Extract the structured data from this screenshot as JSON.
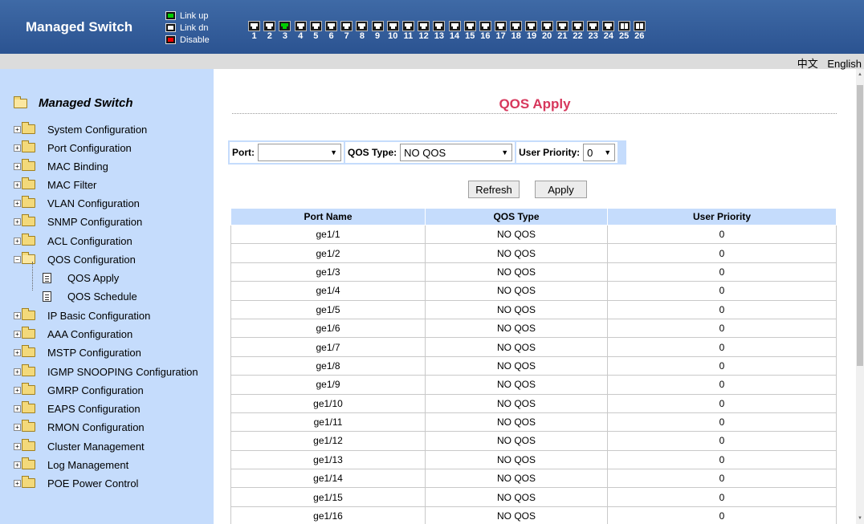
{
  "header": {
    "title": "Managed Switch",
    "legend": {
      "link_up": "Link up",
      "link_dn": "Link dn",
      "disable": "Disable"
    },
    "ports": [
      {
        "num": "1",
        "status": "dn"
      },
      {
        "num": "2",
        "status": "dn"
      },
      {
        "num": "3",
        "status": "up"
      },
      {
        "num": "4",
        "status": "dn"
      },
      {
        "num": "5",
        "status": "dn"
      },
      {
        "num": "6",
        "status": "dn"
      },
      {
        "num": "7",
        "status": "dn"
      },
      {
        "num": "8",
        "status": "dn"
      },
      {
        "num": "9",
        "status": "dn"
      },
      {
        "num": "10",
        "status": "dn"
      },
      {
        "num": "11",
        "status": "dn"
      },
      {
        "num": "12",
        "status": "dn"
      },
      {
        "num": "13",
        "status": "dn"
      },
      {
        "num": "14",
        "status": "dn"
      },
      {
        "num": "15",
        "status": "dn"
      },
      {
        "num": "16",
        "status": "dn"
      },
      {
        "num": "17",
        "status": "dn"
      },
      {
        "num": "18",
        "status": "dn"
      },
      {
        "num": "19",
        "status": "dn"
      },
      {
        "num": "20",
        "status": "dn"
      },
      {
        "num": "21",
        "status": "dn"
      },
      {
        "num": "22",
        "status": "dn"
      },
      {
        "num": "23",
        "status": "dn"
      },
      {
        "num": "24",
        "status": "dn"
      },
      {
        "num": "25",
        "status": "combo"
      },
      {
        "num": "26",
        "status": "combo"
      }
    ]
  },
  "lang": {
    "chinese": "中文",
    "english": "English"
  },
  "sidebar": {
    "root": "Managed Switch",
    "items": [
      "System Configuration",
      "Port Configuration",
      "MAC Binding",
      "MAC Filter",
      "VLAN Configuration",
      "SNMP Configuration",
      "ACL Configuration",
      "QOS Configuration",
      "IP Basic Configuration",
      "AAA Configuration",
      "MSTP Configuration",
      "IGMP SNOOPING Configuration",
      "GMRP Configuration",
      "EAPS Configuration",
      "RMON Configuration",
      "Cluster Management",
      "Log Management",
      "POE Power Control"
    ],
    "sub_items": [
      "QOS Apply",
      "QOS Schedule"
    ]
  },
  "main": {
    "title": "QOS Apply",
    "filters": {
      "port_label": "Port:",
      "port_value": "",
      "qos_type_label": "QOS Type:",
      "qos_type_value": "NO QOS",
      "priority_label": "User Priority:",
      "priority_value": "0"
    },
    "buttons": {
      "refresh": "Refresh",
      "apply": "Apply"
    },
    "table": {
      "columns": [
        "Port Name",
        "QOS Type",
        "User Priority"
      ],
      "rows": [
        [
          "ge1/1",
          "NO QOS",
          "0"
        ],
        [
          "ge1/2",
          "NO QOS",
          "0"
        ],
        [
          "ge1/3",
          "NO QOS",
          "0"
        ],
        [
          "ge1/4",
          "NO QOS",
          "0"
        ],
        [
          "ge1/5",
          "NO QOS",
          "0"
        ],
        [
          "ge1/6",
          "NO QOS",
          "0"
        ],
        [
          "ge1/7",
          "NO QOS",
          "0"
        ],
        [
          "ge1/8",
          "NO QOS",
          "0"
        ],
        [
          "ge1/9",
          "NO QOS",
          "0"
        ],
        [
          "ge1/10",
          "NO QOS",
          "0"
        ],
        [
          "ge1/11",
          "NO QOS",
          "0"
        ],
        [
          "ge1/12",
          "NO QOS",
          "0"
        ],
        [
          "ge1/13",
          "NO QOS",
          "0"
        ],
        [
          "ge1/14",
          "NO QOS",
          "0"
        ],
        [
          "ge1/15",
          "NO QOS",
          "0"
        ],
        [
          "ge1/16",
          "NO QOS",
          "0"
        ]
      ]
    }
  }
}
